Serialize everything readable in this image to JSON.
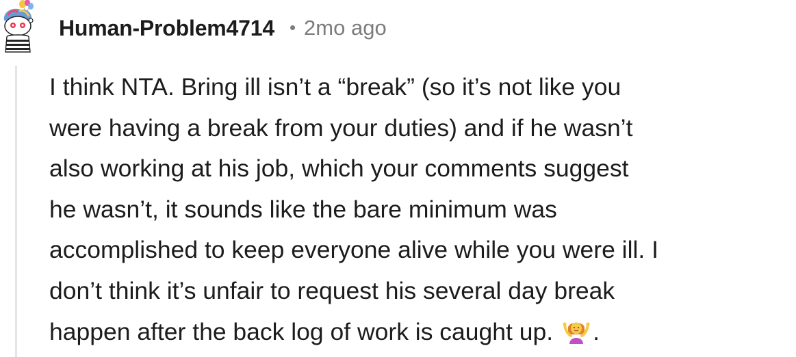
{
  "comment": {
    "author": "Human-Problem4714",
    "separator": "•",
    "timestamp": "2mo ago",
    "body_lines": [
      "I think NTA. Bring ill isn’t a “break” (so it’s not like you",
      "were having a break from your duties) and if he wasn’t",
      "also working at his job, which your comments suggest",
      "he wasn’t, it sounds like the bare minimum was",
      "accomplished to keep everyone alive while you were ill. I",
      "don’t think it’s unfair to request his several day break",
      "happen after the back log of work is caught up."
    ],
    "trailing_text": ".",
    "emoji": "person-shrugging-emoji",
    "avatar": "reddit-snoo-avatar"
  }
}
